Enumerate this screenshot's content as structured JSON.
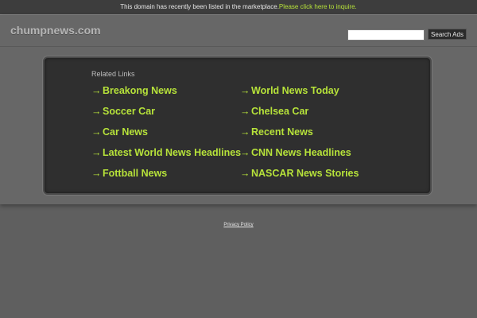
{
  "topbar": {
    "message": "This domain has recently been listed in the marketplace.",
    "inquire_link": "Please click here to inquire."
  },
  "header": {
    "site_name": "chumpnews.com",
    "search_placeholder": "",
    "search_button": "Search Ads"
  },
  "related": {
    "heading": "Related Links",
    "arrow_glyph": "→",
    "left_column": [
      "Breakong News",
      "Soccer Car",
      "Car News",
      "Latest World News Headlines",
      "Fottball News"
    ],
    "right_column": [
      "World News Today",
      "Chelsea Car",
      "Recent News",
      "CNN News Headlines",
      "NASCAR News Stories"
    ]
  },
  "footer": {
    "privacy_link": "Privacy Policy"
  },
  "colors": {
    "accent": "#b7e33a",
    "page_bg": "#5f5f5f",
    "panel_bg": "#2f2f2f",
    "topbar_bg": "#3d3d3d"
  }
}
